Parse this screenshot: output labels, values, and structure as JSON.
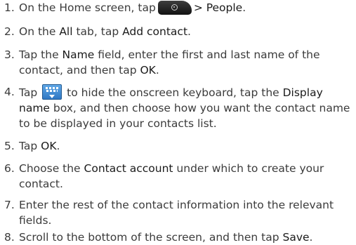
{
  "steps": [
    {
      "num": "1.",
      "a": "On the Home screen, tap",
      "b": "> People",
      "c": "."
    },
    {
      "num": "2.",
      "a": "On the ",
      "b1": "All",
      "c": " tab, tap ",
      "b2": "Add contact",
      "d": "."
    },
    {
      "num": "3.",
      "a": "Tap the ",
      "b1": "Name",
      "c": " field, enter the first and last name of the contact, and then tap ",
      "b2": "OK",
      "d": "."
    },
    {
      "num": "4.",
      "a": "Tap",
      "c": " to hide the onscreen keyboard, tap the ",
      "b1": "Display name",
      "d": " box, and then choose how you want the contact name to be displayed in your contacts list."
    },
    {
      "num": "5.",
      "a": "Tap ",
      "b1": "OK",
      "c": "."
    },
    {
      "num": "6.",
      "a": "Choose the ",
      "b1": "Contact account",
      "c": " under which to create your contact."
    },
    {
      "num": "7.",
      "a": "Enter the rest of the contact information into the relevant fields."
    },
    {
      "num": "8.",
      "a": "Scroll to the bottom of the screen, and then tap ",
      "b1": "Save",
      "c": "."
    }
  ],
  "icons": {
    "home_button": "all-apps-button-icon",
    "keyboard": "hide-keyboard-icon"
  },
  "colors": {
    "text": "#3b3b3b",
    "emphasis": "#1a1a1a",
    "keyboard_icon": "#3e8ad6"
  }
}
